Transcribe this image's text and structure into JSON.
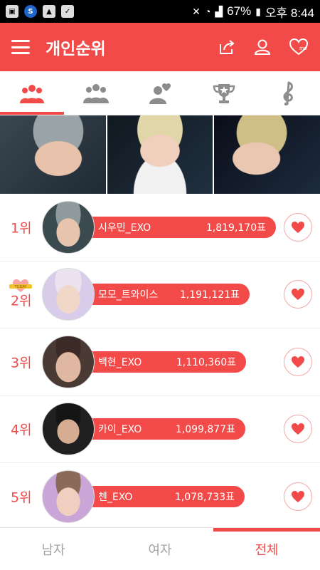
{
  "status_bar": {
    "battery": "67%",
    "time": "오후 8:44"
  },
  "header": {
    "title": "개인순위",
    "actions": [
      "share-icon",
      "user-icon",
      "mv-heart-icon"
    ]
  },
  "category_tabs": [
    {
      "icon": "group-people-icon",
      "active": true
    },
    {
      "icon": "crowd-icon",
      "active": false
    },
    {
      "icon": "person-heart-icon",
      "active": false
    },
    {
      "icon": "trophy-star-icon",
      "active": false
    },
    {
      "icon": "music-clef-icon",
      "active": false
    }
  ],
  "rankings": [
    {
      "rank": "1위",
      "name": "시우민_EXO",
      "votes": "1,819,170표",
      "fill_pct": 100
    },
    {
      "rank": "2위",
      "name": "모모_트와이스",
      "votes": "1,191,121표",
      "fill_pct": 65
    },
    {
      "rank": "3위",
      "name": "백현_EXO",
      "votes": "1,110,360표",
      "fill_pct": 61
    },
    {
      "rank": "4위",
      "name": "카이_EXO",
      "votes": "1,099,877표",
      "fill_pct": 60
    },
    {
      "rank": "5위",
      "name": "첸_EXO",
      "votes": "1,078,733표",
      "fill_pct": 59
    }
  ],
  "bottom_tabs": [
    {
      "label": "남자",
      "active": false
    },
    {
      "label": "여자",
      "active": false
    },
    {
      "label": "전체",
      "active": true
    }
  ],
  "colors": {
    "accent": "#f24a48"
  }
}
